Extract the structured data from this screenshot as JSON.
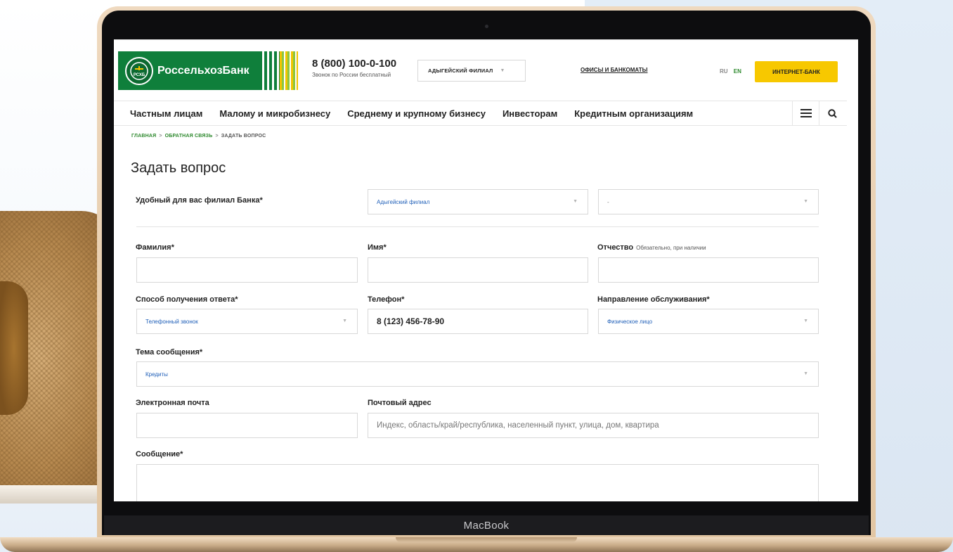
{
  "device": {
    "brand_label": "MacBook"
  },
  "header": {
    "logo_text": "РоссельхозБанк",
    "logo_seal_text": "РСХБ",
    "phone_number": "8 (800) 100-0-100",
    "phone_note": "Звонок по России бесплатный",
    "branch_selector": "АДЫГЕЙСКИЙ ФИЛИАЛ",
    "offices_link": "ОФИСЫ И БАНКОМАТЫ",
    "lang_ru": "RU",
    "lang_en": "EN",
    "internet_bank_button": "ИНТЕРНЕТ-БАНК"
  },
  "nav": {
    "items": [
      {
        "label": "Частным лицам"
      },
      {
        "label": "Малому и микробизнесу"
      },
      {
        "label": "Среднему и крупному бизнесу"
      },
      {
        "label": "Инвесторам"
      },
      {
        "label": "Кредитным организациям"
      }
    ],
    "menu_icon": "hamburger-icon",
    "search_icon": "search-icon"
  },
  "breadcrumbs": {
    "home": "ГЛАВНАЯ",
    "feedback": "ОБРАТНАЯ СВЯЗЬ",
    "current": "ЗАДАТЬ ВОПРОС",
    "separator": ">"
  },
  "form": {
    "title": "Задать вопрос",
    "branch_label": "Удобный для вас филиал Банка*",
    "branch_value": "Адыгейский филиал",
    "office_value": "-",
    "last_name_label": "Фамилия*",
    "last_name_value": "",
    "first_name_label": "Имя*",
    "first_name_value": "",
    "patronymic_label": "Отчество",
    "patronymic_hint": "Обязательно, при наличии",
    "patronymic_value": "",
    "answer_method_label": "Способ получения ответа*",
    "answer_method_value": "Телефонный звонок",
    "phone_label": "Телефон*",
    "phone_value": "8 (123) 456-78-90",
    "service_direction_label": "Направление обслуживания*",
    "service_direction_value": "Физическое лицо",
    "topic_label": "Тема сообщения*",
    "topic_value": "Кредиты",
    "email_label": "Электронная почта",
    "email_value": "",
    "postal_label": "Почтовый адрес",
    "postal_placeholder": "Индекс, область/край/республика, населенный пункт, улица, дом, квартира",
    "message_label": "Сообщение*",
    "message_value": ""
  },
  "colors": {
    "brand_green": "#0f7f3b",
    "accent_yellow": "#f7c800",
    "link_green": "#2f8a2f",
    "select_value_blue": "#1f5fb8"
  }
}
